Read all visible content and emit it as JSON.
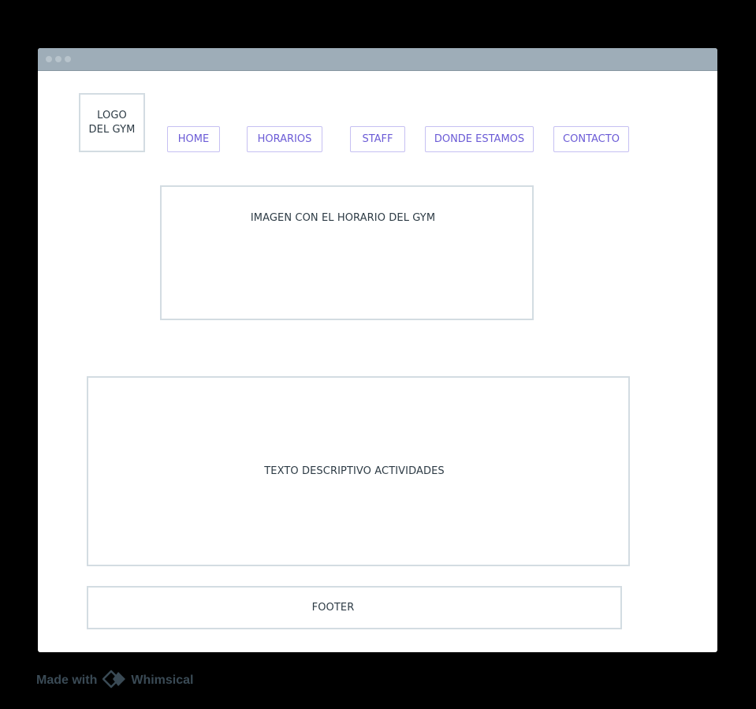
{
  "logo": {
    "line1": "LOGO",
    "line2": "DEL GYM"
  },
  "nav": {
    "items": [
      {
        "label": "HOME"
      },
      {
        "label": "HORARIOS"
      },
      {
        "label": "STAFF"
      },
      {
        "label": "DONDE ESTAMOS"
      },
      {
        "label": "CONTACTO"
      }
    ]
  },
  "hero": {
    "text": "IMAGEN CON EL HORARIO DEL GYM"
  },
  "content": {
    "text": "TEXTO DESCRIPTIVO ACTIVIDADES"
  },
  "footer": {
    "text": "FOOTER"
  },
  "brand": {
    "prefix": "Made with",
    "name": "Whimsical"
  },
  "colors": {
    "page_background": "#000000",
    "titlebar": "#9eadb8",
    "box_border": "#d3dce2",
    "nav_text": "#6b5bd6",
    "nav_border": "#c6c0f2",
    "body_text": "#2d3b45"
  },
  "icons": {
    "brand_logo": "whimsical-diamond-icon"
  }
}
